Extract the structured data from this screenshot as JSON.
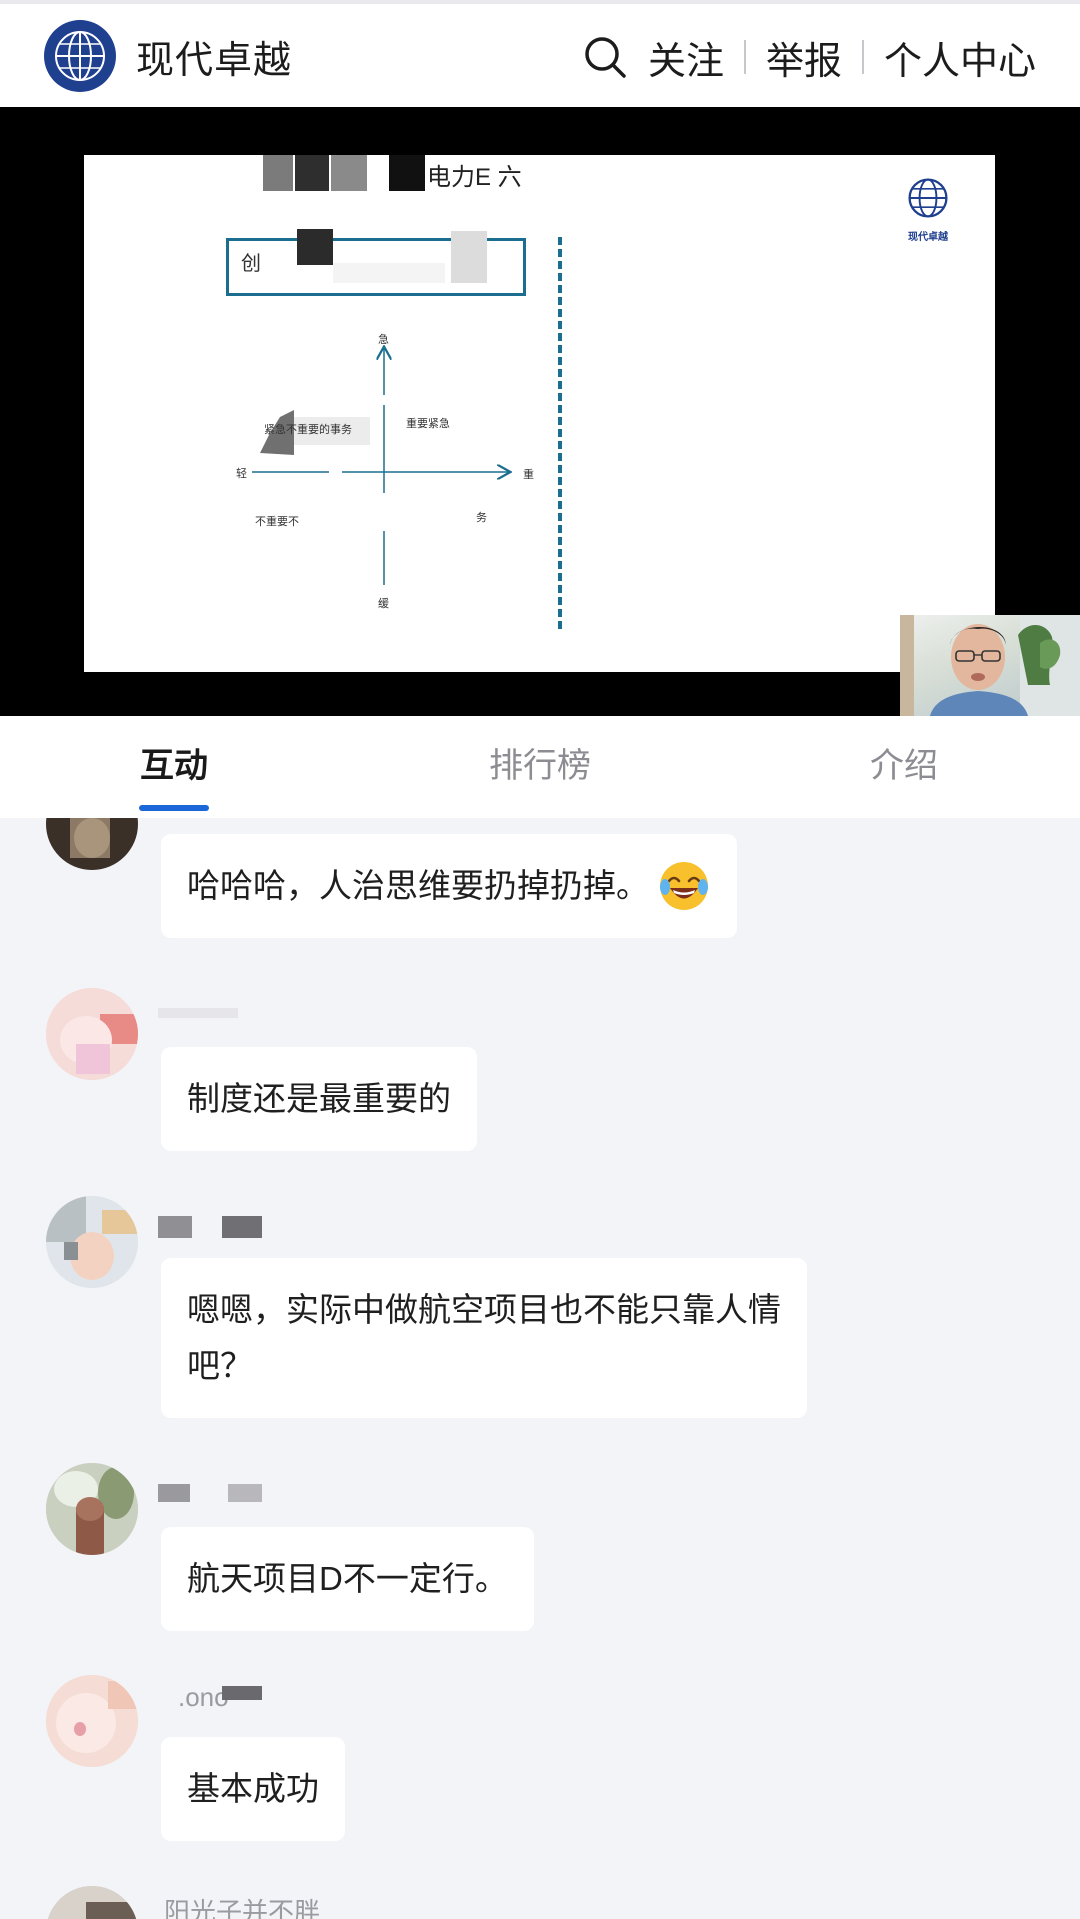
{
  "header": {
    "brand_name": "现代卓越",
    "nav": {
      "follow": "关注",
      "report": "举报",
      "profile": "个人中心"
    }
  },
  "slide": {
    "title_fragment": "电力E 六",
    "box_char": "创",
    "axis": {
      "top": "急",
      "bottom": "缓",
      "left": "轻",
      "right": "重"
    },
    "quadrants": {
      "top_left": "紧急不重要的事务",
      "top_right": "重要紧急",
      "bottom_left": "不重要不",
      "bottom_right": "务"
    },
    "logo_text": "现代卓越"
  },
  "tabs": [
    {
      "label": "互动",
      "active": true
    },
    {
      "label": "排行榜",
      "active": false
    },
    {
      "label": "介绍",
      "active": false
    }
  ],
  "comments": [
    {
      "username": "",
      "text": "哈哈哈，人治思维要扔掉扔掉。"
    },
    {
      "username": "",
      "text": "制度还是最重要的"
    },
    {
      "username": "",
      "text_line1": "嗯嗯，实际中做航空项目也不能只靠人情",
      "text_line2": "吧？"
    },
    {
      "username": "",
      "text": "航天项目D不一定行。"
    },
    {
      "username": ".ono",
      "text": "基本成功"
    },
    {
      "username": "阳光子并不胖",
      "text": ""
    }
  ],
  "colors": {
    "accent": "#1b66d8",
    "slide_line": "#1b6e8f",
    "background": "#f3f4f8"
  }
}
